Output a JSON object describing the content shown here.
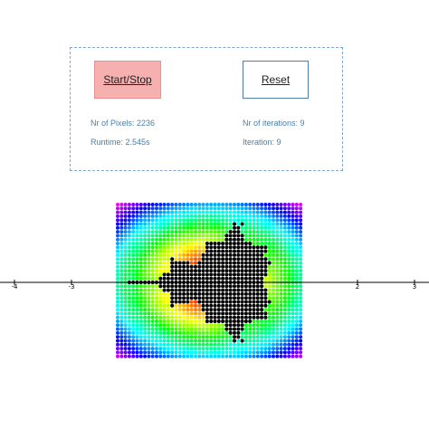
{
  "controls": {
    "start_stop_label": "Start/Stop",
    "reset_label": "Reset"
  },
  "stats": {
    "pixels": "Nr of Pixels: 2236",
    "runtime": "Runtime: 2.545s",
    "iterations_total": "Nr of iterations: 9",
    "iteration": "Iteration: 9"
  },
  "axis": {
    "ticks": [
      {
        "label": "-4"
      },
      {
        "label": "-3"
      },
      {
        "label": "2"
      },
      {
        "label": "3"
      }
    ]
  },
  "colors": {
    "set_color": "#000000",
    "axis_color": "#000000"
  }
}
